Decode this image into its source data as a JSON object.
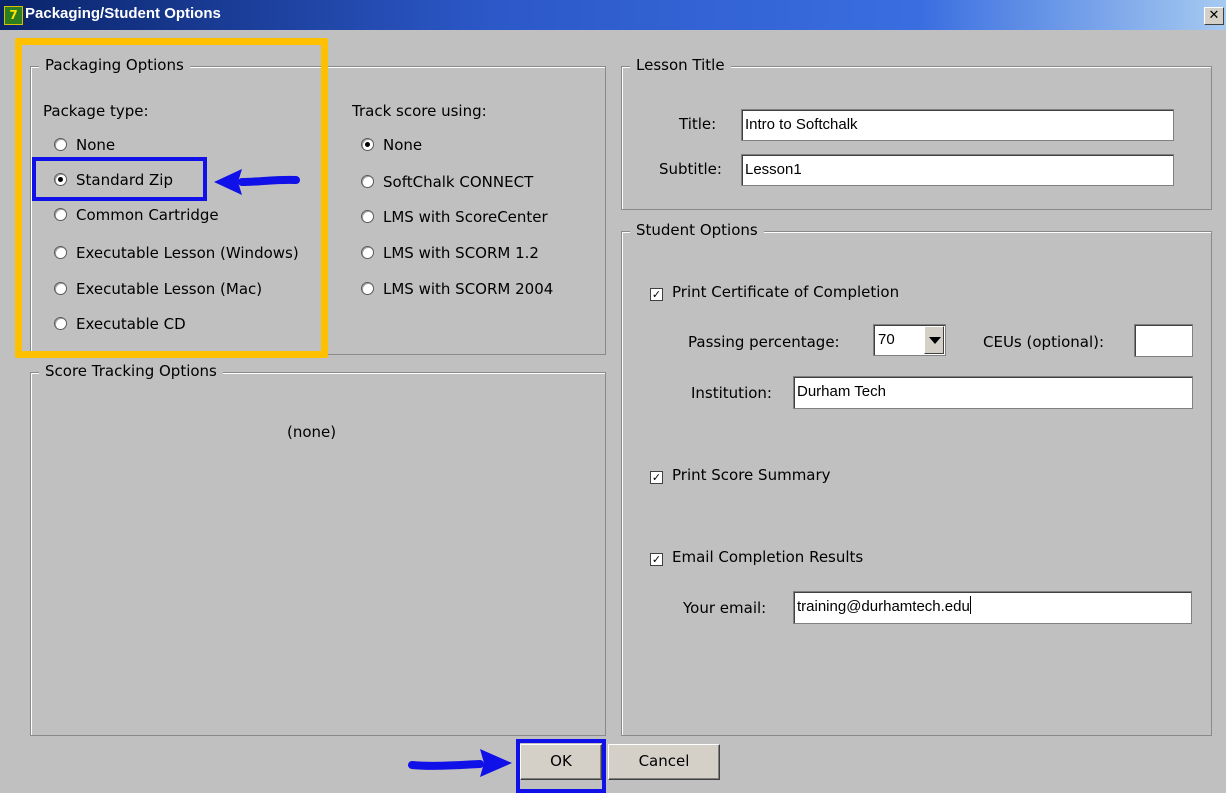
{
  "window": {
    "title": "Packaging/Student Options",
    "icon_text": "7",
    "close_glyph": "✕"
  },
  "packaging": {
    "legend": "Packaging Options",
    "package_type_label": "Package type:",
    "package_types": [
      {
        "label": "None",
        "selected": false
      },
      {
        "label": "Standard Zip",
        "selected": true
      },
      {
        "label": "Common Cartridge",
        "selected": false
      },
      {
        "label": "Executable Lesson (Windows)",
        "selected": false
      },
      {
        "label": "Executable Lesson (Mac)",
        "selected": false
      },
      {
        "label": "Executable CD",
        "selected": false
      }
    ],
    "track_label": "Track score using:",
    "track_options": [
      {
        "label": "None",
        "selected": true
      },
      {
        "label": "SoftChalk CONNECT",
        "selected": false
      },
      {
        "label": "LMS with ScoreCenter",
        "selected": false
      },
      {
        "label": "LMS with SCORM 1.2",
        "selected": false
      },
      {
        "label": "LMS with SCORM 2004",
        "selected": false
      }
    ]
  },
  "score_tracking": {
    "legend": "Score Tracking Options",
    "empty_text": "(none)"
  },
  "lesson_title": {
    "legend": "Lesson Title",
    "title_label": "Title:",
    "title_value": "Intro to Softchalk",
    "subtitle_label": "Subtitle:",
    "subtitle_value": "Lesson1"
  },
  "student_options": {
    "legend": "Student Options",
    "print_certificate": {
      "label": "Print Certificate of Completion",
      "checked": true
    },
    "passing_label": "Passing percentage:",
    "passing_value": "70",
    "ceus_label": "CEUs (optional):",
    "ceus_value": "",
    "institution_label": "Institution:",
    "institution_value": "Durham Tech",
    "print_score": {
      "label": "Print Score Summary",
      "checked": true
    },
    "email_results": {
      "label": "Email Completion Results",
      "checked": true
    },
    "email_label": "Your email:",
    "email_value": "training@durhamtech.edu"
  },
  "buttons": {
    "ok": "OK",
    "cancel": "Cancel"
  },
  "annotation_colors": {
    "highlight_yellow": "#ffc000",
    "highlight_blue": "#1010e8"
  }
}
